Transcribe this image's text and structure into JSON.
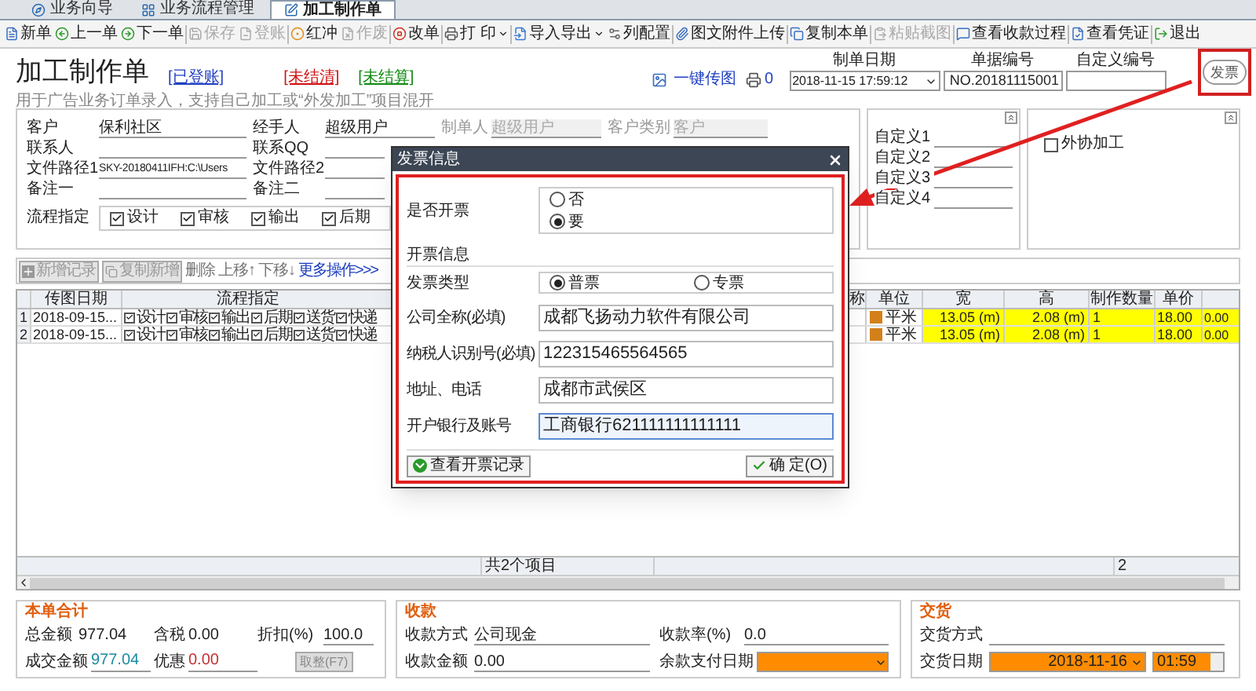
{
  "tabs": [
    {
      "label": "业务向导",
      "selected": false
    },
    {
      "label": "业务流程管理",
      "selected": false
    },
    {
      "label": "加工制作单",
      "selected": true
    }
  ],
  "toolbar": [
    {
      "label": "新单",
      "disabled": false,
      "dropdown": false
    },
    {
      "label": "上一单",
      "disabled": false,
      "dropdown": false
    },
    {
      "label": "下一单",
      "disabled": false,
      "dropdown": false
    },
    {
      "label": "保存",
      "disabled": true,
      "dropdown": false
    },
    {
      "label": "登账",
      "disabled": true,
      "dropdown": false
    },
    {
      "label": "红冲",
      "disabled": false,
      "dropdown": false
    },
    {
      "label": "作废",
      "disabled": true,
      "dropdown": false
    },
    {
      "label": "改单",
      "disabled": false,
      "dropdown": false
    },
    {
      "label": "打 印",
      "disabled": false,
      "dropdown": true
    },
    {
      "label": "导入导出",
      "disabled": false,
      "dropdown": true
    },
    {
      "label": "列配置",
      "disabled": false,
      "dropdown": false
    },
    {
      "label": "图文附件上传",
      "disabled": false,
      "dropdown": false
    },
    {
      "label": "复制本单",
      "disabled": false,
      "dropdown": false
    },
    {
      "label": "粘贴截图",
      "disabled": true,
      "dropdown": false
    },
    {
      "label": "查看收款过程",
      "disabled": false,
      "dropdown": false
    },
    {
      "label": "查看凭证",
      "disabled": false,
      "dropdown": false
    },
    {
      "label": "退出",
      "disabled": false,
      "dropdown": false
    }
  ],
  "header": {
    "title": "加工制作单",
    "status_tags": [
      {
        "label": "[已登账]",
        "color": "#2040c0"
      },
      {
        "label": "[未结清]",
        "color": "#d01010"
      },
      {
        "label": "[未结算]",
        "color": "#108a10"
      }
    ],
    "subtitle": "用于广告业务订单录入，支持自己加工或“外发加工”项目混开",
    "upload_link": "一键传图",
    "print_count": "0",
    "date": {
      "label": "制单日期",
      "value": "2018-11-15 17:59:12"
    },
    "number": {
      "label": "单据编号",
      "value": "NO.20181115001"
    },
    "custom_number": {
      "label": "自定义编号"
    },
    "stamp": "发票"
  },
  "form": {
    "rows": [
      [
        {
          "label": "客户",
          "value": "保利社区",
          "disabled": false
        },
        {
          "label": "经手人",
          "value": "超级用户",
          "disabled": false
        },
        {
          "label": "制单人",
          "value": "超级用户",
          "disabled": true
        },
        {
          "label": "客户类别",
          "value": "客户",
          "disabled": true
        }
      ],
      [
        {
          "label": "联系人",
          "disabled": false
        },
        {
          "label": "联系QQ",
          "disabled": false
        }
      ],
      [
        {
          "label": "文件路径1",
          "value": "SKY-20180411IFH:C:\\Users",
          "disabled": false
        },
        {
          "label": "文件路径2",
          "disabled": false
        }
      ],
      [
        {
          "label": "备注一",
          "disabled": false
        },
        {
          "label": "备注二",
          "disabled": false
        }
      ]
    ],
    "flow": {
      "label": "流程指定",
      "items": [
        {
          "label": "设计",
          "checked": true
        },
        {
          "label": "审核",
          "checked": true
        },
        {
          "label": "输出",
          "checked": true
        },
        {
          "label": "后期",
          "checked": true
        }
      ]
    }
  },
  "custom_fields": [
    "自定义1",
    "自定义2",
    "自定义3",
    "自定义4"
  ],
  "outsourcing": {
    "label": "外协加工",
    "checked": false
  },
  "actions": [
    {
      "label": "新增记录",
      "kind": "button",
      "disabled": true
    },
    {
      "label": "复制新增",
      "kind": "button",
      "disabled": true
    },
    {
      "label": "删除",
      "kind": "text",
      "disabled": false
    },
    {
      "label": "上移↑",
      "kind": "text",
      "disabled": false
    },
    {
      "label": "下移↓",
      "kind": "text",
      "disabled": false
    },
    {
      "label": "更多操作>>>",
      "kind": "link",
      "disabled": false
    }
  ],
  "table": {
    "columns_left": [
      "传图日期",
      "流程指定"
    ],
    "columns_right": [
      "称",
      "单位",
      "宽",
      "高",
      "制作数量",
      "单价"
    ],
    "rows": [
      {
        "index": "1",
        "date": "2018-09-15...",
        "flow": [
          {
            "label": "设计",
            "checked": true
          },
          {
            "label": "审核",
            "checked": true
          },
          {
            "label": "输出",
            "checked": true
          },
          {
            "label": "后期",
            "checked": true
          },
          {
            "label": "送货",
            "checked": true
          },
          {
            "label": "快递",
            "checked": true
          }
        ],
        "unit": "平米",
        "color": "#d4801a",
        "width": "13.05 (m)",
        "height": "2.08 (m)",
        "qty": "1",
        "price": "18.00",
        "column_8": "0.00"
      },
      {
        "index": "2",
        "date": "2018-09-15...",
        "flow": [
          {
            "label": "设计",
            "checked": true
          },
          {
            "label": "审核",
            "checked": true
          },
          {
            "label": "输出",
            "checked": true
          },
          {
            "label": "后期",
            "checked": true
          },
          {
            "label": "送货",
            "checked": true
          },
          {
            "label": "快递",
            "checked": true
          }
        ],
        "unit": "平米",
        "color": "#d4801a",
        "width": "13.05 (m)",
        "height": "2.08 (m)",
        "qty": "1",
        "price": "18.00",
        "column_8": "0.00"
      }
    ],
    "footer": {
      "count": "共2个项目",
      "total": "2"
    }
  },
  "summary": {
    "title": "本单合计",
    "total_label": "总金额",
    "total": "977.04",
    "tax_label": "含税",
    "tax": "0.00",
    "discount_label": "折扣(%)",
    "discount": "100.0",
    "deal_label": "成交金额",
    "deal": "977.04",
    "offer_label": "优惠",
    "offer": "0.00",
    "round_button": "取整(F7)"
  },
  "payment": {
    "title": "收款",
    "method_label": "收款方式",
    "method": "公司现金",
    "rate_label": "收款率(%)",
    "rate": "0.0",
    "amount_label": "收款金额",
    "amount": "0.00",
    "due_label": "余款支付日期"
  },
  "delivery": {
    "title": "交货",
    "method_label": "交货方式",
    "date_label": "交货日期",
    "date": "2018-11-16",
    "time": "01:59"
  },
  "dialog": {
    "title": "发票信息",
    "invoice_question": {
      "label": "是否开票",
      "options": [
        {
          "label": "否",
          "selected": false
        },
        {
          "label": "要",
          "selected": true
        }
      ]
    },
    "section": "开票信息",
    "invoice_type": {
      "label": "发票类型",
      "options": [
        {
          "label": "普票",
          "selected": true
        },
        {
          "label": "专票",
          "selected": false
        }
      ]
    },
    "fields": [
      {
        "label": "公司全称(必填)",
        "value": "成都飞扬动力软件有限公司",
        "focused": false
      },
      {
        "label": "纳税人识别号(必填)",
        "value": "122315465564565",
        "focused": false
      },
      {
        "label": "地址、电话",
        "value": "成都市武侯区",
        "focused": false
      },
      {
        "label": "开户银行及账号",
        "value": "工商银行621111111111111",
        "focused": true
      }
    ],
    "buttons": [
      {
        "label": "查看开票记录",
        "kind": "history"
      },
      {
        "label": "确 定(O)",
        "kind": "confirm"
      }
    ]
  }
}
